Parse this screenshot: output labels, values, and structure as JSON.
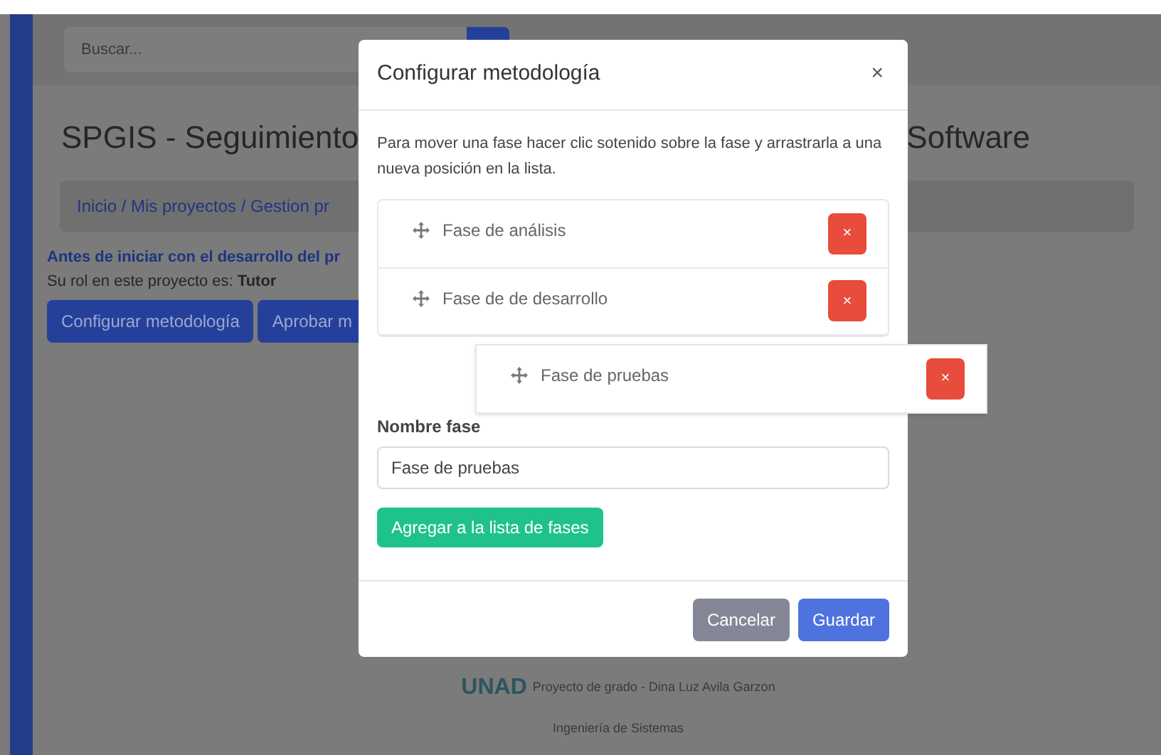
{
  "page": {
    "search": {
      "placeholder": "Buscar..."
    },
    "title_start": "SPGIS - Seguimiento",
    "title_end": "Software",
    "breadcrumb": "Inicio / Mis proyectos / Gestion pr",
    "notice": "Antes de iniciar con el desarrollo del pr",
    "role": "Su rol en este proyecto es: **Tutor**",
    "buttons": [
      "Configurar metodología",
      "Aprobar m"
    ],
    "footer": {
      "logo": "UNAD",
      "credit": "Proyecto de grado - Dina Luz Avila Garzon",
      "program": "Ingeniería de Sistemas"
    }
  },
  "modal": {
    "title": "Configurar metodología",
    "close": "×",
    "instructions": "Para mover una fase hacer clic sotenido sobre la fase y arrastrarla a una nueva posición en la lista.",
    "phases": [
      {
        "name": "Fase de análisis",
        "remove": "×",
        "dragging": false
      },
      {
        "name": "Fase de de desarrollo",
        "remove": "×",
        "dragging": false
      },
      {
        "name": "Fase de pruebas",
        "remove": "×",
        "dragging": true
      }
    ],
    "field": {
      "label": "Nombre fase",
      "value": "Fase de pruebas"
    },
    "add_button": "Agregar a la lista de fases",
    "buttons": [
      {
        "label": "Cancelar",
        "kind": "secondary"
      },
      {
        "label": "Guardar",
        "kind": "primary"
      }
    ]
  }
}
